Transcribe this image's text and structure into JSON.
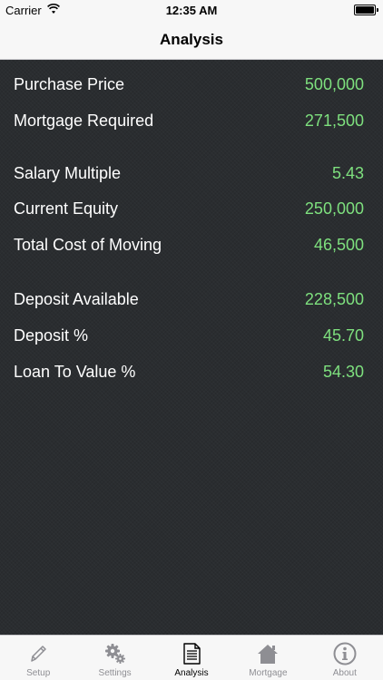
{
  "status_bar": {
    "carrier": "Carrier",
    "time": "12:35 AM"
  },
  "nav": {
    "title": "Analysis"
  },
  "rows": [
    {
      "label": "Purchase Price",
      "value": "500,000"
    },
    {
      "label": "Mortgage Required",
      "value": "271,500"
    },
    {
      "label": "Salary Multiple",
      "value": "5.43"
    },
    {
      "label": "Current Equity",
      "value": "250,000"
    },
    {
      "label": "Total Cost of Moving",
      "value": "46,500"
    },
    {
      "label": "Deposit Available",
      "value": "228,500"
    },
    {
      "label": "Deposit %",
      "value": "45.70"
    },
    {
      "label": "Loan To Value %",
      "value": "54.30"
    }
  ],
  "tabs": [
    {
      "label": "Setup",
      "icon": "pencil-icon"
    },
    {
      "label": "Settings",
      "icon": "gears-icon"
    },
    {
      "label": "Analysis",
      "icon": "document-icon",
      "active": true
    },
    {
      "label": "Mortgage",
      "icon": "house-icon"
    },
    {
      "label": "About",
      "icon": "info-icon"
    }
  ],
  "colors": {
    "value_green": "#7ee07e",
    "background": "#2a2d30",
    "bar_background": "#f7f7f7"
  }
}
